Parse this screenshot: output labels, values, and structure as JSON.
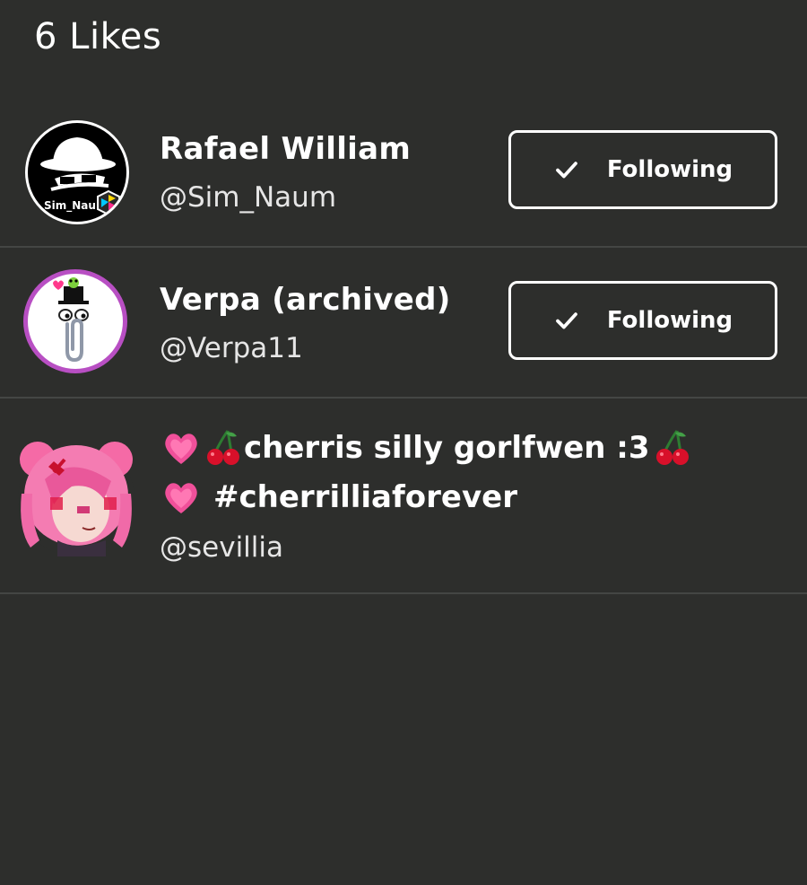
{
  "header": {
    "title": "6 Likes"
  },
  "users": [
    {
      "name": "Rafael William",
      "handle": "@Sim_Naum",
      "avatar_text": "Sim_Nau",
      "follow_label": "Following"
    },
    {
      "name": "Verpa (archived)",
      "handle": "@Verpa11",
      "follow_label": "Following"
    },
    {
      "name_line1": "cherris silly gorlfwen :3",
      "name_line2": "#cherrilliaforever",
      "handle": "@sevillia"
    }
  ],
  "icons": {
    "check": "check-icon",
    "heart": "pink-heart-icon",
    "cherry": "cherry-icon"
  },
  "colors": {
    "background": "#2d2e2c",
    "divider": "#444644",
    "text": "#ffffff",
    "heart": "#f0509a",
    "cherry": "#d8102a"
  }
}
